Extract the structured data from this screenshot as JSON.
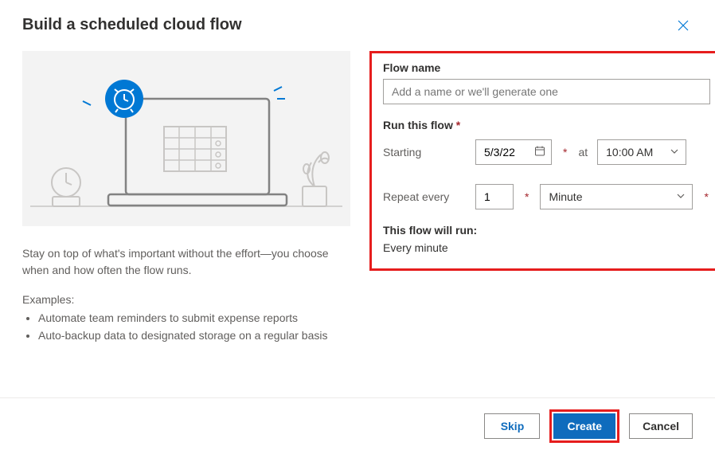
{
  "header": {
    "title": "Build a scheduled cloud flow"
  },
  "left": {
    "description": "Stay on top of what's important without the effort—you choose when and how often the flow runs.",
    "examples_heading": "Examples:",
    "examples": [
      "Automate team reminders to submit expense reports",
      "Auto-backup data to designated storage on a regular basis"
    ]
  },
  "form": {
    "flow_name_label": "Flow name",
    "flow_name_placeholder": "Add a name or we'll generate one",
    "flow_name_value": "",
    "run_label": "Run this flow",
    "starting_label": "Starting",
    "starting_date": "5/3/22",
    "at_label": "at",
    "starting_time": "10:00 AM",
    "repeat_label": "Repeat every",
    "repeat_count": "1",
    "repeat_unit": "Minute",
    "summary_label": "This flow will run:",
    "summary_text": "Every minute"
  },
  "footer": {
    "skip": "Skip",
    "create": "Create",
    "cancel": "Cancel"
  }
}
